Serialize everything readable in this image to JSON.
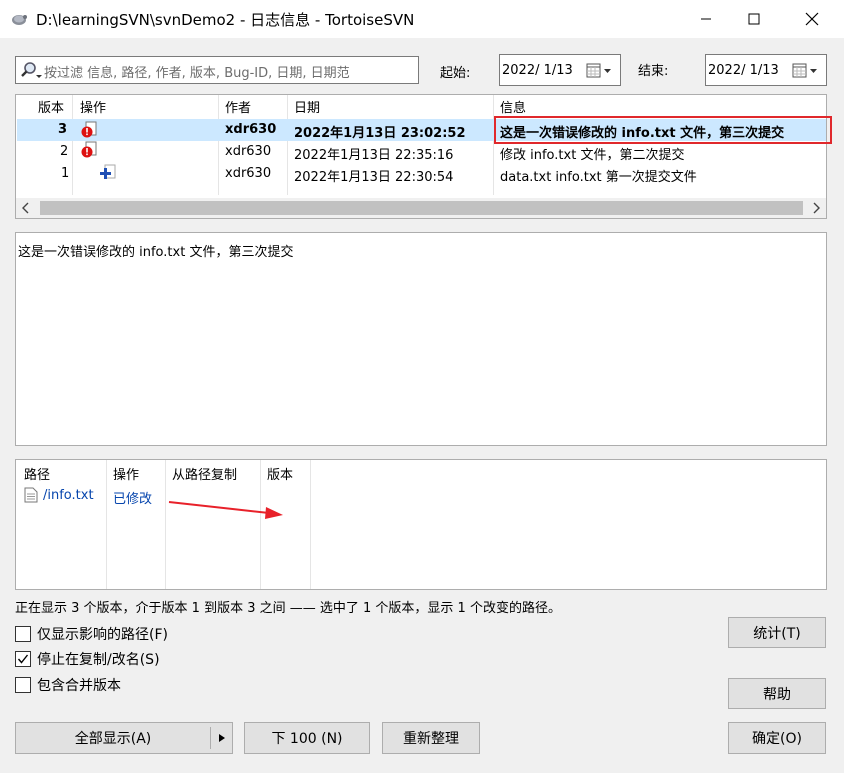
{
  "window": {
    "title": "D:\\learningSVN\\svnDemo2 - 日志信息 - TortoiseSVN"
  },
  "filter": {
    "placeholder": "按过滤 信息, 路径, 作者, 版本, Bug-ID, 日期, 日期范"
  },
  "date_range": {
    "from_label": "起始:",
    "from_value": "2022/  1/13",
    "to_label": "结束:",
    "to_value": "2022/  1/13"
  },
  "revisions": {
    "headers": [
      "版本",
      "操作",
      "作者",
      "日期",
      "信息"
    ],
    "rows": [
      {
        "revision": "3",
        "author": "xdr630",
        "date": "2022年1月13日 23:02:52",
        "message": "这是一次错误修改的 info.txt 文件，第三次提交",
        "selected": true,
        "action_icon": "modified-icon"
      },
      {
        "revision": "2",
        "author": "xdr630",
        "date": "2022年1月13日 22:35:16",
        "message": "修改 info.txt 文件，第二次提交",
        "selected": false,
        "action_icon": "modified-icon"
      },
      {
        "revision": "1",
        "author": "xdr630",
        "date": "2022年1月13日 22:30:54",
        "message": "data.txt info.txt 第一次提交文件",
        "selected": false,
        "action_icon": "added-icon"
      }
    ]
  },
  "message_pane": {
    "text": "这是一次错误修改的 info.txt 文件，第三次提交"
  },
  "changed_paths": {
    "headers": [
      "路径",
      "操作",
      "从路径复制",
      "版本"
    ],
    "rows": [
      {
        "path": "/info.txt",
        "action": "已修改",
        "copy_from": "",
        "revision": ""
      }
    ]
  },
  "status": {
    "text": "正在显示 3 个版本，介于版本 1 到版本 3 之间 —— 选中了 1 个版本，显示 1 个改变的路径。"
  },
  "options": {
    "only_affected": {
      "label": "仅显示影响的路径(F)",
      "checked": false
    },
    "stop_on_copy": {
      "label": "停止在复制/改名(S)",
      "checked": true
    },
    "include_merged": {
      "label": "包含合并版本",
      "checked": false
    }
  },
  "buttons": {
    "statistics": "统计(T)",
    "help": "帮助",
    "show_all": "全部显示(A)",
    "next_100": "下 100 (N)",
    "refresh": "重新整理",
    "ok": "确定(O)"
  },
  "colors": {
    "selection": "#cce8ff",
    "highlight_box": "#e0282c",
    "path_link": "#0645ad",
    "arrow": "#e8212a"
  }
}
